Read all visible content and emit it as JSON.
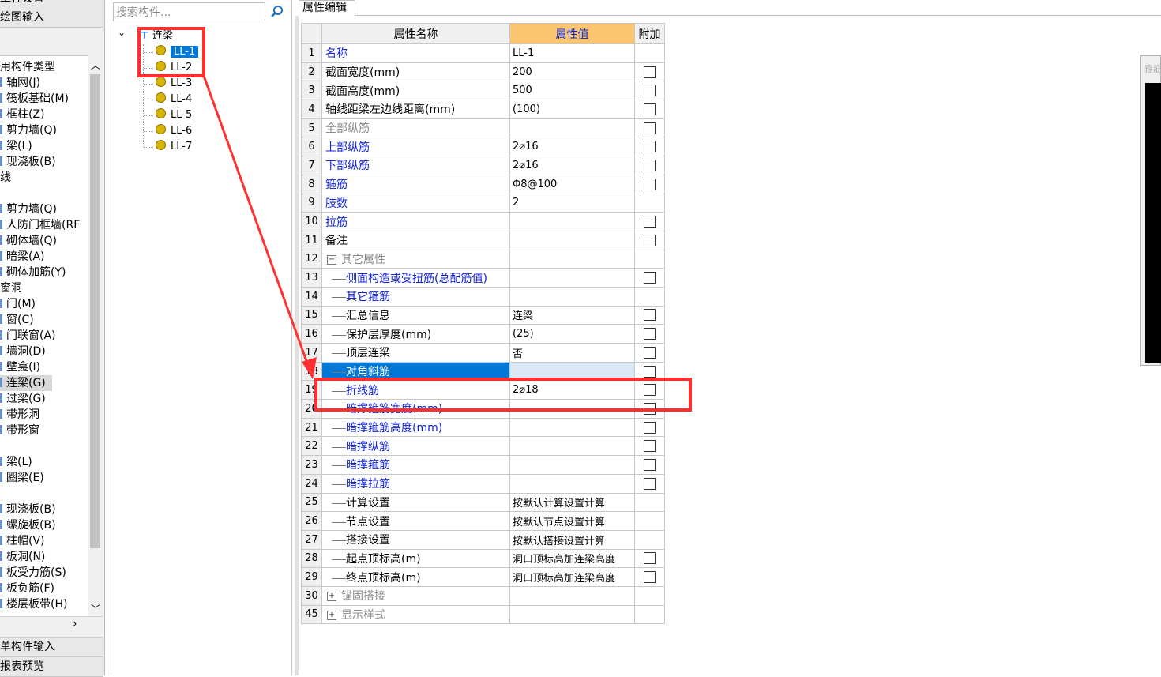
{
  "left_panel": {
    "top_header_partial": "工程设置",
    "header_draw": "绘图输入",
    "footer_single": "单构件输入",
    "footer_report": "报表预览",
    "tree_items": [
      {
        "label": "用构件类型",
        "mark": false
      },
      {
        "label": "轴网(J)",
        "mark": true
      },
      {
        "label": "筏板基础(M)",
        "mark": true
      },
      {
        "label": "框柱(Z)",
        "mark": true
      },
      {
        "label": "剪力墙(Q)",
        "mark": true
      },
      {
        "label": "梁(L)",
        "mark": true
      },
      {
        "label": "现浇板(B)",
        "mark": true
      },
      {
        "label": "线",
        "mark": false
      },
      {
        "label": "",
        "mark": false
      },
      {
        "label": "剪力墙(Q)",
        "mark": true
      },
      {
        "label": "人防门框墙(RF",
        "mark": true
      },
      {
        "label": "砌体墙(Q)",
        "mark": true
      },
      {
        "label": "暗梁(A)",
        "mark": true
      },
      {
        "label": "砌体加筋(Y)",
        "mark": true
      },
      {
        "label": "窗洞",
        "mark": false
      },
      {
        "label": "门(M)",
        "mark": true
      },
      {
        "label": "窗(C)",
        "mark": true
      },
      {
        "label": "门联窗(A)",
        "mark": true
      },
      {
        "label": "墙洞(D)",
        "mark": true
      },
      {
        "label": "壁龛(I)",
        "mark": true
      },
      {
        "label": "连梁(G)",
        "mark": true,
        "selected": true
      },
      {
        "label": "过梁(G)",
        "mark": true
      },
      {
        "label": "带形洞",
        "mark": true
      },
      {
        "label": "带形窗",
        "mark": true
      },
      {
        "label": "",
        "mark": false
      },
      {
        "label": "梁(L)",
        "mark": true
      },
      {
        "label": "圈梁(E)",
        "mark": true
      },
      {
        "label": "",
        "mark": false
      },
      {
        "label": "现浇板(B)",
        "mark": true
      },
      {
        "label": "螺旋板(B)",
        "mark": true
      },
      {
        "label": "柱帽(V)",
        "mark": true
      },
      {
        "label": "板洞(N)",
        "mark": true
      },
      {
        "label": "板受力筋(S)",
        "mark": true
      },
      {
        "label": "板负筋(F)",
        "mark": true
      },
      {
        "label": "楼层板带(H)",
        "mark": true
      }
    ]
  },
  "search": {
    "placeholder": "搜索构件..."
  },
  "component_tree": {
    "root": "连梁",
    "items": [
      "LL-1",
      "LL-2",
      "LL-3",
      "LL-4",
      "LL-5",
      "LL-6",
      "LL-7"
    ],
    "selected_index": 0
  },
  "tab": {
    "label": "属性编辑"
  },
  "table": {
    "headers": {
      "name": "属性名称",
      "value": "属性值",
      "extra": "附加"
    },
    "rows": [
      {
        "num": "1",
        "name": "名称",
        "value": "LL-1",
        "style": "link",
        "indent": false,
        "check": false
      },
      {
        "num": "2",
        "name": "截面宽度(mm)",
        "value": "200",
        "style": "normal",
        "indent": false,
        "check": true
      },
      {
        "num": "3",
        "name": "截面高度(mm)",
        "value": "500",
        "style": "normal",
        "indent": false,
        "check": true
      },
      {
        "num": "4",
        "name": "轴线距梁左边线距离(mm)",
        "value": "(100)",
        "style": "normal",
        "indent": false,
        "check": true
      },
      {
        "num": "5",
        "name": "全部纵筋",
        "value": "",
        "style": "gray",
        "indent": false,
        "check": true
      },
      {
        "num": "6",
        "name": "上部纵筋",
        "value": "2⌀16",
        "style": "link",
        "indent": false,
        "check": true
      },
      {
        "num": "7",
        "name": "下部纵筋",
        "value": "2⌀16",
        "style": "link",
        "indent": false,
        "check": true
      },
      {
        "num": "8",
        "name": "箍筋",
        "value": "Φ8@100",
        "style": "link",
        "indent": false,
        "check": true
      },
      {
        "num": "9",
        "name": "肢数",
        "value": "2",
        "style": "link",
        "indent": false,
        "check": false
      },
      {
        "num": "10",
        "name": "拉筋",
        "value": "",
        "style": "link",
        "indent": false,
        "check": true
      },
      {
        "num": "11",
        "name": "备注",
        "value": "",
        "style": "normal",
        "indent": false,
        "check": true
      },
      {
        "num": "12",
        "name": "其它属性",
        "value": "",
        "style": "gray",
        "indent": false,
        "check": false,
        "expander": "−"
      },
      {
        "num": "13",
        "name": "侧面构造或受扭筋(总配筋值)",
        "value": "",
        "style": "link",
        "indent": true,
        "check": true
      },
      {
        "num": "14",
        "name": "其它箍筋",
        "value": "",
        "style": "link",
        "indent": true,
        "check": false
      },
      {
        "num": "15",
        "name": "汇总信息",
        "value": "连梁",
        "style": "normal",
        "indent": true,
        "check": true
      },
      {
        "num": "16",
        "name": "保护层厚度(mm)",
        "value": "(25)",
        "style": "normal",
        "indent": true,
        "check": true
      },
      {
        "num": "17",
        "name": "顶层连梁",
        "value": "否",
        "style": "normal",
        "indent": true,
        "check": true
      },
      {
        "num": "18",
        "name": "对角斜筋",
        "value": "",
        "style": "link",
        "indent": true,
        "check": true,
        "selected": true
      },
      {
        "num": "19",
        "name": "折线筋",
        "value": "2⌀18",
        "style": "link",
        "indent": true,
        "check": true
      },
      {
        "num": "20",
        "name": "暗撑箍筋宽度(mm)",
        "value": "",
        "style": "link",
        "indent": true,
        "check": true
      },
      {
        "num": "21",
        "name": "暗撑箍筋高度(mm)",
        "value": "",
        "style": "link",
        "indent": true,
        "check": true
      },
      {
        "num": "22",
        "name": "暗撑纵筋",
        "value": "",
        "style": "link",
        "indent": true,
        "check": true
      },
      {
        "num": "23",
        "name": "暗撑箍筋",
        "value": "",
        "style": "link",
        "indent": true,
        "check": true
      },
      {
        "num": "24",
        "name": "暗撑拉筋",
        "value": "",
        "style": "link",
        "indent": true,
        "check": true
      },
      {
        "num": "25",
        "name": "计算设置",
        "value": "按默认计算设置计算",
        "style": "normal",
        "indent": true,
        "check": false
      },
      {
        "num": "26",
        "name": "节点设置",
        "value": "按默认节点设置计算",
        "style": "normal",
        "indent": true,
        "check": false
      },
      {
        "num": "27",
        "name": "搭接设置",
        "value": "按默认搭接设置计算",
        "style": "normal",
        "indent": true,
        "check": false
      },
      {
        "num": "28",
        "name": "起点顶标高(m)",
        "value": "洞口顶标高加连梁高度",
        "style": "normal",
        "indent": true,
        "check": true
      },
      {
        "num": "29",
        "name": "终点顶标高(m)",
        "value": "洞口顶标高加连梁高度",
        "style": "normal",
        "indent": true,
        "check": true
      },
      {
        "num": "30",
        "name": "锚固搭接",
        "value": "",
        "style": "gray",
        "indent": false,
        "check": false,
        "expander": "+"
      },
      {
        "num": "45",
        "name": "显示样式",
        "value": "",
        "style": "gray",
        "indent": false,
        "check": false,
        "expander": "+"
      }
    ]
  },
  "preview": {
    "title_partial": "箍筋"
  },
  "colors": {
    "accent_blue": "#0078d7",
    "link_blue": "#1022d8",
    "header_orange": "#fbc66f",
    "annotation_red": "#ff3030"
  }
}
